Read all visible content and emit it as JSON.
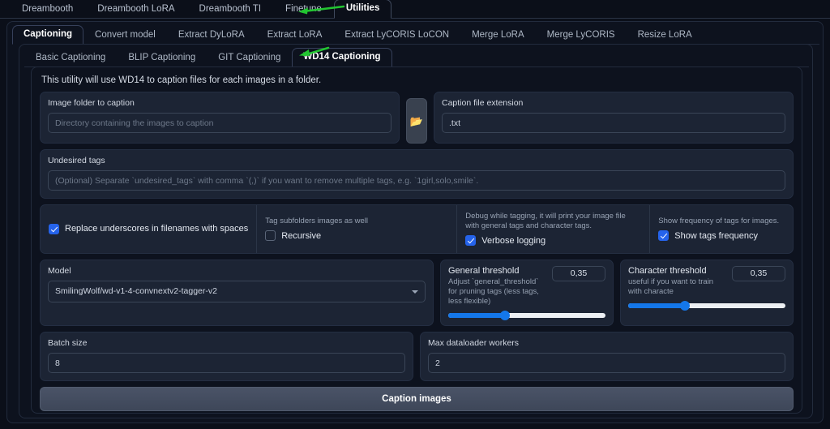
{
  "top_tabs": [
    {
      "label": "Dreambooth",
      "active": false
    },
    {
      "label": "Dreambooth LoRA",
      "active": false
    },
    {
      "label": "Dreambooth TI",
      "active": false
    },
    {
      "label": "Finetune",
      "active": false
    },
    {
      "label": "Utilities",
      "active": true
    }
  ],
  "second_tabs": [
    {
      "label": "Captioning",
      "active": true
    },
    {
      "label": "Convert model",
      "active": false
    },
    {
      "label": "Extract DyLoRA",
      "active": false
    },
    {
      "label": "Extract LoRA",
      "active": false
    },
    {
      "label": "Extract LyCORIS LoCON",
      "active": false
    },
    {
      "label": "Merge LoRA",
      "active": false
    },
    {
      "label": "Merge LyCORIS",
      "active": false
    },
    {
      "label": "Resize LoRA",
      "active": false
    }
  ],
  "third_tabs": [
    {
      "label": "Basic Captioning",
      "active": false
    },
    {
      "label": "BLIP Captioning",
      "active": false
    },
    {
      "label": "GIT Captioning",
      "active": false
    },
    {
      "label": "WD14 Captioning",
      "active": true
    }
  ],
  "intro_text": "This utility will use WD14 to caption files for each images in a folder.",
  "image_folder": {
    "label": "Image folder to caption",
    "value": "",
    "placeholder": "Directory containing the images to caption"
  },
  "folder_button": {
    "icon": "folder-icon",
    "glyph": "📂"
  },
  "caption_extension": {
    "label": "Caption file extension",
    "value": ".txt",
    "placeholder": ""
  },
  "undesired_tags": {
    "label": "Undesired tags",
    "value": "",
    "placeholder": "(Optional) Separate `undesired_tags` with comma `(,)` if you want to remove multiple tags, e.g. `1girl,solo,smile`."
  },
  "options": {
    "replace_underscores": {
      "label": "Replace underscores in filenames with spaces",
      "checked": true,
      "hint": ""
    },
    "recursive": {
      "label": "Recursive",
      "checked": false,
      "hint": "Tag subfolders images as well"
    },
    "verbose_logging": {
      "label": "Verbose logging",
      "checked": true,
      "hint": "Debug while tagging, it will print your image file with general tags and character tags."
    },
    "show_tags_frequency": {
      "label": "Show tags frequency",
      "checked": true,
      "hint": "Show frequency of tags for images."
    }
  },
  "model": {
    "label": "Model",
    "value": "SmilingWolf/wd-v1-4-convnextv2-tagger-v2",
    "options": [
      "SmilingWolf/wd-v1-4-convnextv2-tagger-v2"
    ]
  },
  "general_threshold": {
    "title": "General threshold",
    "subtitle": "Adjust `general_threshold` for pruning tags (less tags, less flexible)",
    "value": "0,35",
    "percent": 36
  },
  "character_threshold": {
    "title": "Character threshold",
    "subtitle": "useful if you want to train with characte",
    "value": "0,35",
    "percent": 36
  },
  "batch_size": {
    "label": "Batch size",
    "value": "8"
  },
  "max_dataloader_workers": {
    "label": "Max dataloader workers",
    "value": "2"
  },
  "caption_button": {
    "label": "Caption images"
  },
  "colors": {
    "accent_blue": "#2563eb",
    "slider_blue": "#1477ea",
    "folder_yellow": "#f0b35a",
    "annotation_green": "#22c531",
    "page_background": "#0b0f19",
    "panel_background": "#1c2434"
  },
  "annotations": [
    {
      "name": "arrow-to-utilities-tab",
      "color": "#22c531"
    },
    {
      "name": "arrow-to-wd14-captioning-tab",
      "color": "#22c531"
    }
  ]
}
